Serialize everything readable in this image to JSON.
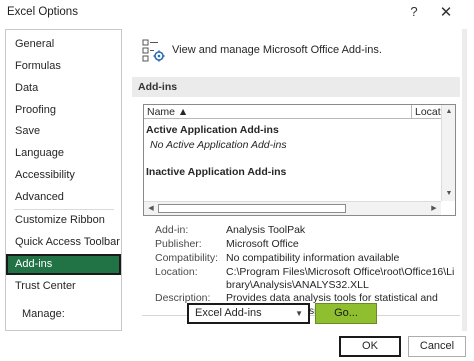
{
  "window": {
    "title": "Excel Options",
    "help_glyph": "?",
    "close_glyph": "✕"
  },
  "sidebar": {
    "items": [
      {
        "label": "General"
      },
      {
        "label": "Formulas"
      },
      {
        "label": "Data"
      },
      {
        "label": "Proofing"
      },
      {
        "label": "Save"
      },
      {
        "label": "Language"
      },
      {
        "label": "Accessibility"
      },
      {
        "label": "Advanced"
      },
      {
        "label": "Customize Ribbon"
      },
      {
        "label": "Quick Access Toolbar"
      },
      {
        "label": "Add-ins"
      },
      {
        "label": "Trust Center"
      }
    ],
    "selected": "Add-ins"
  },
  "main": {
    "header_text": "View and manage Microsoft Office Add-ins.",
    "header_icon": "addins-gear-icon",
    "section_title": "Add-ins",
    "list": {
      "columns": [
        "Name ▲",
        "Locatio"
      ],
      "rows": [
        {
          "text": "Active Application Add-ins",
          "kind": "group"
        },
        {
          "text": "No Active Application Add-ins",
          "kind": "note"
        },
        {
          "text": "Inactive Application Add-ins",
          "kind": "group"
        }
      ]
    },
    "details": {
      "addin_label": "Add-in:",
      "addin_value": "Analysis ToolPak",
      "publisher_label": "Publisher:",
      "publisher_value": "Microsoft Office",
      "compat_label": "Compatibility:",
      "compat_value": "No compatibility information available",
      "location_label": "Location:",
      "location_value": "C:\\Program Files\\Microsoft Office\\root\\Office16\\Library\\Analysis\\ANALYS32.XLL",
      "desc_label": "Description:",
      "desc_value": "Provides data analysis tools for statistical and engineering analysis"
    },
    "manage": {
      "label": "Manage:",
      "selected": "Excel Add-ins",
      "go_label": "Go..."
    }
  },
  "footer": {
    "ok_label": "OK",
    "cancel_label": "Cancel"
  },
  "colors": {
    "accent": "#217346",
    "go_button": "#8fbf2e",
    "section_bar": "#ebebeb"
  }
}
